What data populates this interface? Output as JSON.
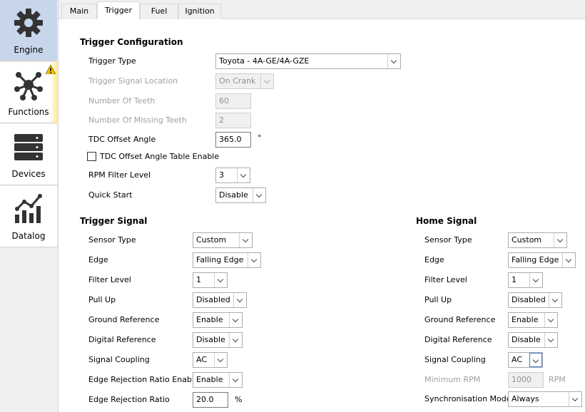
{
  "sidebar": {
    "items": [
      {
        "label": "Engine",
        "icon": "gear-icon"
      },
      {
        "label": "Functions",
        "icon": "network-icon"
      },
      {
        "label": "Devices",
        "icon": "server-icon"
      },
      {
        "label": "Datalog",
        "icon": "chart-icon"
      }
    ]
  },
  "tabs": [
    "Main",
    "Trigger",
    "Fuel",
    "Ignition"
  ],
  "trigger_config": {
    "title": "Trigger Configuration",
    "trigger_type_label": "Trigger Type",
    "trigger_type_value": "Toyota - 4A-GE/4A-GZE",
    "signal_location_label": "Trigger Signal Location",
    "signal_location_value": "On Crank",
    "num_teeth_label": "Number Of Teeth",
    "num_teeth_value": "60",
    "missing_teeth_label": "Number Of Missing Teeth",
    "missing_teeth_value": "2",
    "tdc_offset_label": "TDC Offset Angle",
    "tdc_offset_value": "365.0",
    "tdc_offset_unit": "°",
    "tdc_table_label": "TDC Offset Angle Table Enable",
    "rpm_filter_label": "RPM Filter Level",
    "rpm_filter_value": "3",
    "quick_start_label": "Quick Start",
    "quick_start_value": "Disable"
  },
  "trigger_signal": {
    "title": "Trigger Signal",
    "sensor_type_label": "Sensor Type",
    "sensor_type_value": "Custom",
    "edge_label": "Edge",
    "edge_value": "Falling Edge",
    "filter_label": "Filter Level",
    "filter_value": "1",
    "pullup_label": "Pull Up",
    "pullup_value": "Disabled",
    "ground_ref_label": "Ground Reference",
    "ground_ref_value": "Enable",
    "digital_ref_label": "Digital Reference",
    "digital_ref_value": "Disable",
    "coupling_label": "Signal Coupling",
    "coupling_value": "AC",
    "edge_rej_enable_label": "Edge Rejection Ratio Enable",
    "edge_rej_enable_value": "Enable",
    "edge_rej_label": "Edge Rejection Ratio",
    "edge_rej_value": "20.0",
    "edge_rej_unit": "%"
  },
  "home_signal": {
    "title": "Home Signal",
    "sensor_type_label": "Sensor Type",
    "sensor_type_value": "Custom",
    "edge_label": "Edge",
    "edge_value": "Falling Edge",
    "filter_label": "Filter Level",
    "filter_value": "1",
    "pullup_label": "Pull Up",
    "pullup_value": "Disabled",
    "ground_ref_label": "Ground Reference",
    "ground_ref_value": "Enable",
    "digital_ref_label": "Digital Reference",
    "digital_ref_value": "Disable",
    "coupling_label": "Signal Coupling",
    "coupling_value": "AC",
    "min_rpm_label": "Minimum RPM",
    "min_rpm_value": "1000",
    "min_rpm_unit": "RPM",
    "sync_mode_label": "Synchronisation Mode",
    "sync_mode_value": "Always"
  },
  "colors": {
    "accent": "#3b7ddd",
    "active_sidebar": "#c7d6ea",
    "warning": "#f5c400"
  }
}
